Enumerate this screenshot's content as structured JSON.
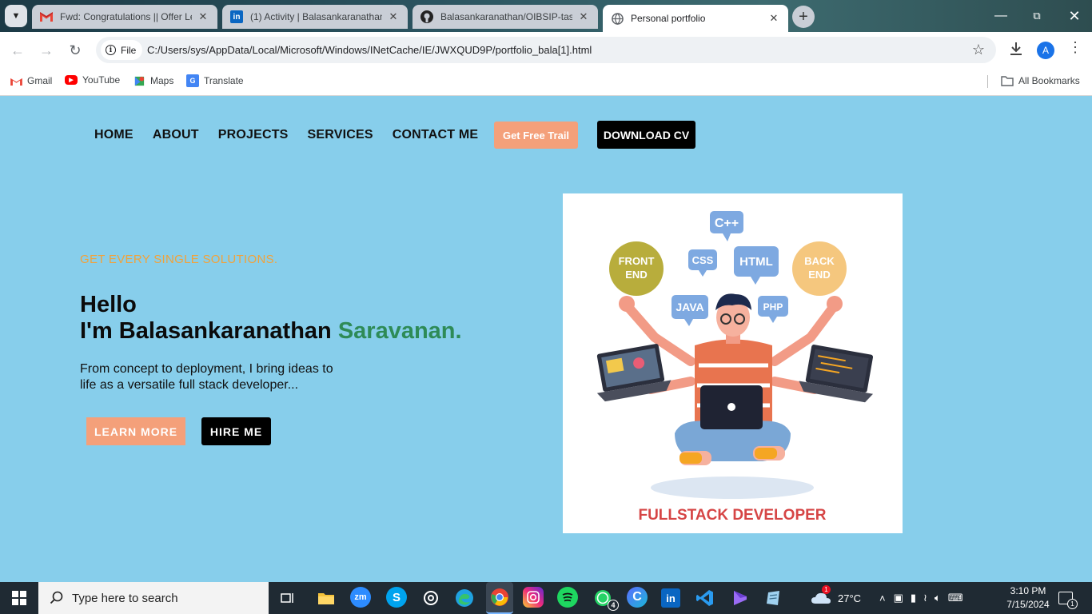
{
  "browser": {
    "tabs": [
      {
        "title": "Fwd: Congratulations || Offer Le",
        "icon": "gmail-icon"
      },
      {
        "title": "(1) Activity | Balasankaranathan",
        "icon": "linkedin-icon"
      },
      {
        "title": "Balasankaranathan/OIBSIP-task",
        "icon": "github-icon"
      },
      {
        "title": "Personal portfolio",
        "icon": "globe-icon"
      }
    ],
    "security_chip": "File",
    "url": "C:/Users/sys/AppData/Local/Microsoft/Windows/INetCache/IE/JWXQUD9P/portfolio_bala[1].html",
    "profile_initial": "A",
    "bookmarks": [
      {
        "label": "Gmail"
      },
      {
        "label": "YouTube"
      },
      {
        "label": "Maps"
      },
      {
        "label": "Translate"
      }
    ],
    "all_bookmarks": "All Bookmarks"
  },
  "page": {
    "nav": [
      "HOME",
      "ABOUT",
      "PROJECTS",
      "SERVICES",
      "CONTACT ME"
    ],
    "trial_button": "Get Free Trail",
    "cv_button": "DOWNLOAD CV",
    "tagline": "GET EVERY SINGLE SOLUTIONS.",
    "hello": "Hello",
    "name_prefix": "I'm Balasankaranathan ",
    "name_highlight": "Saravanan.",
    "description": "From concept to deployment, I bring ideas to life as a versatile full stack developer...",
    "learn_button": "LEARN MORE",
    "hire_button": "HIRE ME",
    "hero": {
      "bubbles": [
        "C++",
        "CSS",
        "HTML",
        "JAVA",
        "PHP"
      ],
      "front_end": [
        "FRONT",
        "END"
      ],
      "back_end": [
        "BACK",
        "END"
      ],
      "caption": "FULLSTACK DEVELOPER"
    },
    "colors": {
      "background": "#87ceeb",
      "accent_orange": "#f4a07a",
      "tagline": "#f2a23a",
      "name_highlight": "#2e8b57"
    }
  },
  "taskbar": {
    "search_placeholder": "Type here to search",
    "weather": "27°C",
    "time": "3:10 PM",
    "date": "7/15/2024",
    "whatsapp_badge": "4",
    "weather_badge": "1",
    "notification_badge": "1"
  }
}
